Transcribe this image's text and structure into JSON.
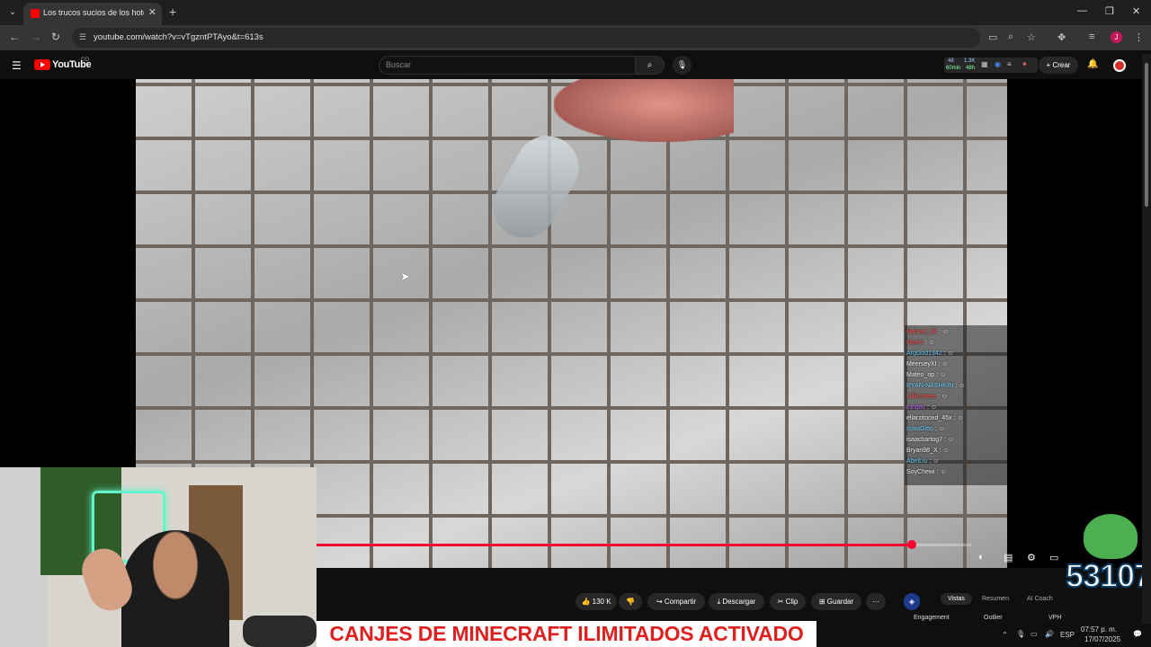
{
  "browser": {
    "tab_title": "Los trucos sucios de los hoteles",
    "url": "youtube.com/watch?v=vTgzntPTAyo&t=613s",
    "new_tab": "+",
    "profile_initial": "J"
  },
  "youtube": {
    "logo_text": "YouTube",
    "country_code": "CO",
    "search_placeholder": "Buscar",
    "create_label": "Crear",
    "ext_stats": [
      "48",
      "60min",
      "1.3K",
      "48h"
    ]
  },
  "chat": {
    "messages": [
      {
        "name": "Nahuel_28",
        "color": "#ff4d4d"
      },
      {
        "name": "Illsent",
        "color": "#ff4d4d"
      },
      {
        "name": "ArgGod1342",
        "color": "#6bd0ff"
      },
      {
        "name": "MeerseyXI",
        "color": "#ffffff"
      },
      {
        "name": "Mateo_rip",
        "color": "#ffffff"
      },
      {
        "name": "RYAN-NASHKIN",
        "color": "#6bd0ff"
      },
      {
        "name": "LilBumeee",
        "color": "#ff4d4d"
      },
      {
        "name": "tungoy",
        "color": "#c070ff"
      },
      {
        "name": "eliarzitooxd_45x",
        "color": "#ffffff"
      },
      {
        "name": "IsmaGitto",
        "color": "#6bd0ff"
      },
      {
        "name": "isaacbartog7",
        "color": "#ffffff"
      },
      {
        "name": "Bryan98_X",
        "color": "#ffffff"
      },
      {
        "name": "AbelLiu",
        "color": "#6bd0ff"
      },
      {
        "name": "SoyChewi",
        "color": "#ffffff"
      }
    ]
  },
  "actions": {
    "likes": "130 K",
    "share": "Compartir",
    "download": "Descargar",
    "clip": "Clip",
    "save": "Guardar",
    "more": "···"
  },
  "side_panel": {
    "tabs": [
      "Vistas",
      "Resumen",
      "AI Coach"
    ],
    "sub": [
      "Engagement",
      "Outlier",
      "VPH"
    ]
  },
  "overlay": {
    "banner_text": "CANJES DE MINECRAFT ILIMITADOS ACTIVADO",
    "meme_count": "53107"
  },
  "playback": {
    "progress_fraction": 0.91
  },
  "tray": {
    "language": "ESP",
    "time": "07:57 p. m.",
    "date": "17/07/2025"
  },
  "colors": {
    "accent_red": "#ff0033",
    "banner_text": "#e0201f"
  }
}
